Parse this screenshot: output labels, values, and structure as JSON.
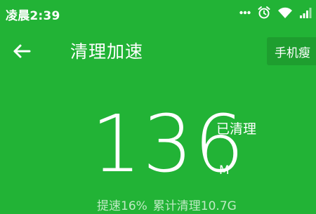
{
  "status_bar": {
    "time": "凌晨2:39",
    "icons": [
      "more-dots-icon",
      "alarm-clock-icon",
      "wifi-icon",
      "signal-icon"
    ]
  },
  "toolbar": {
    "back_icon": "back-arrow-icon",
    "title": "清理加速",
    "slim_button_label": "手机瘦"
  },
  "result": {
    "amount": "136",
    "label": "已清理",
    "unit": "M"
  },
  "summary": {
    "speedup": "提速16%",
    "total_cleaned": "累计清理10.7G"
  },
  "colors": {
    "background": "#22b336",
    "button_bg": "#1e9e2f",
    "text": "#ffffff",
    "summary_text": "#bfeac4"
  }
}
